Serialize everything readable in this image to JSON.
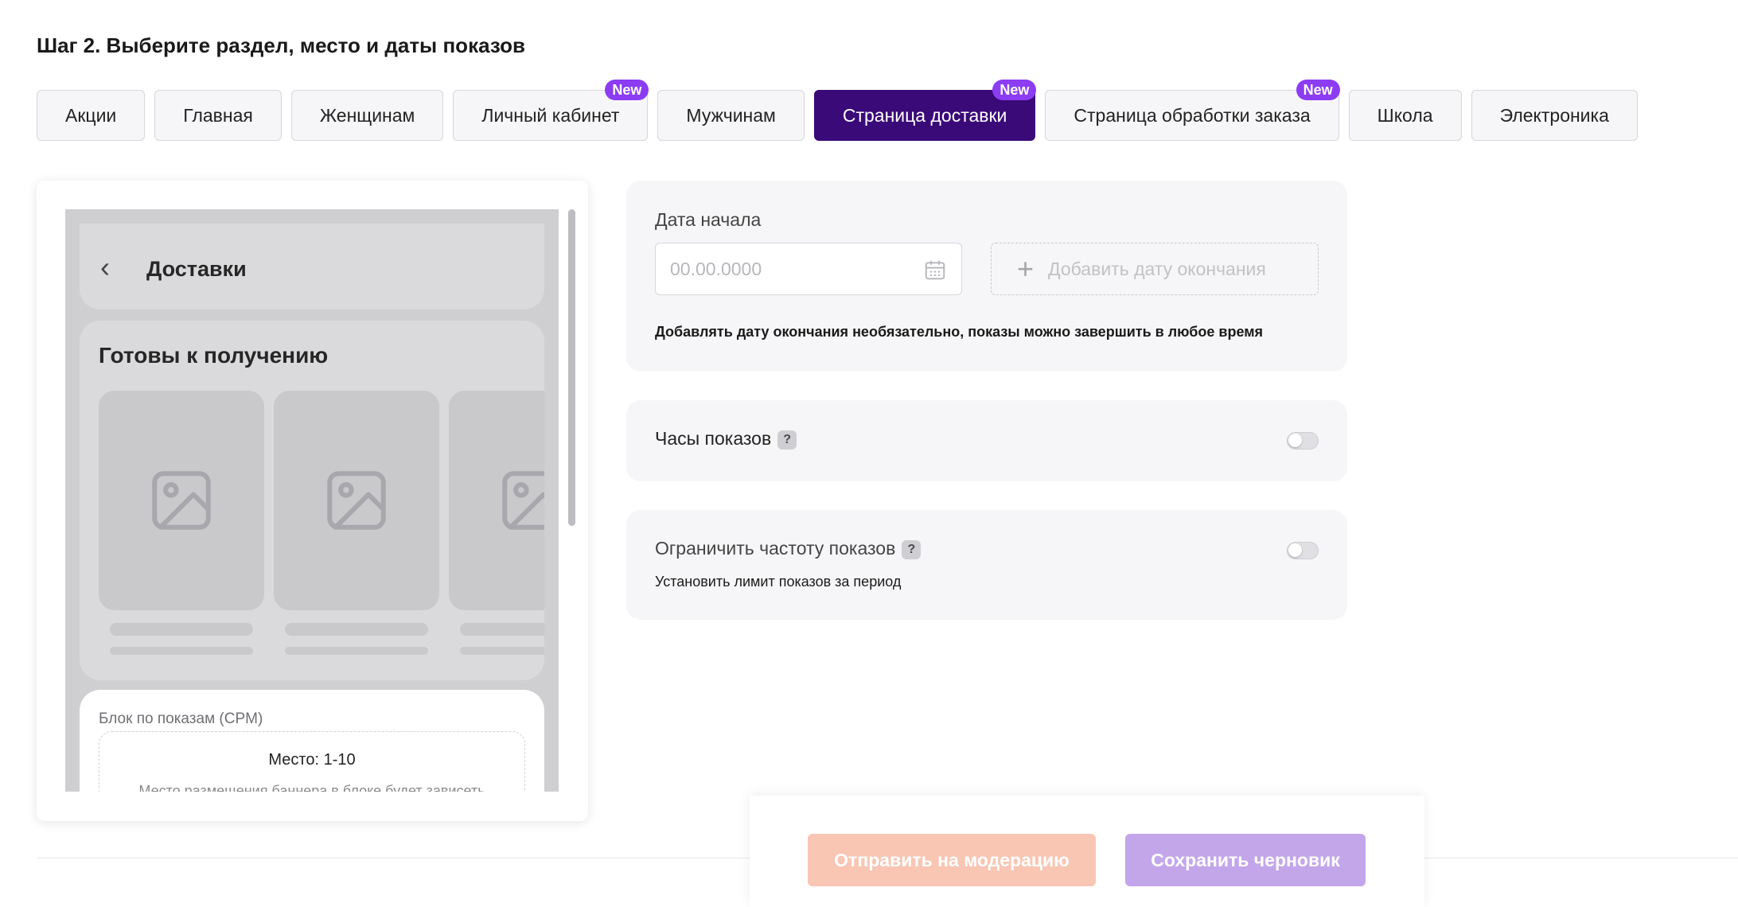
{
  "page": {
    "step_title": "Шаг 2. Выберите раздел, место и даты показов"
  },
  "tabs": [
    {
      "label": "Акции",
      "badge": "",
      "active": false
    },
    {
      "label": "Главная",
      "badge": "",
      "active": false
    },
    {
      "label": "Женщинам",
      "badge": "",
      "active": false
    },
    {
      "label": "Личный кабинет",
      "badge": "New",
      "active": false
    },
    {
      "label": "Мужчинам",
      "badge": "",
      "active": false
    },
    {
      "label": "Страница доставки",
      "badge": "New",
      "active": true
    },
    {
      "label": "Страница обработки заказа",
      "badge": "New",
      "active": false
    },
    {
      "label": "Школа",
      "badge": "",
      "active": false
    },
    {
      "label": "Электроника",
      "badge": "",
      "active": false
    }
  ],
  "preview": {
    "header_title": "Доставки",
    "section_title": "Готовы к получению",
    "block_label": "Блок по показам (CPM)",
    "place": "Место: 1-10",
    "place_desc": "Место размещения баннера в блоке будет зависеть"
  },
  "date_panel": {
    "start_label": "Дата начала",
    "start_placeholder": "00.00.0000",
    "add_end_label": "Добавить дату окончания",
    "hint": "Добавлять дату окончания необязательно, показы можно завершить в любое время"
  },
  "hours_panel": {
    "label": "Часы показов",
    "help": "?",
    "enabled": false
  },
  "freq_panel": {
    "label": "Ограничить частоту показов",
    "help": "?",
    "hint": "Установить лимит показов за период",
    "enabled": false
  },
  "footer": {
    "moderate_label": "Отправить на модерацию",
    "draft_label": "Сохранить черновик"
  },
  "colors": {
    "accent": "#3a0a78",
    "badge": "#8c3cf2",
    "moderate_btn": "#f8c6b3",
    "draft_btn": "#c3a6ea"
  }
}
